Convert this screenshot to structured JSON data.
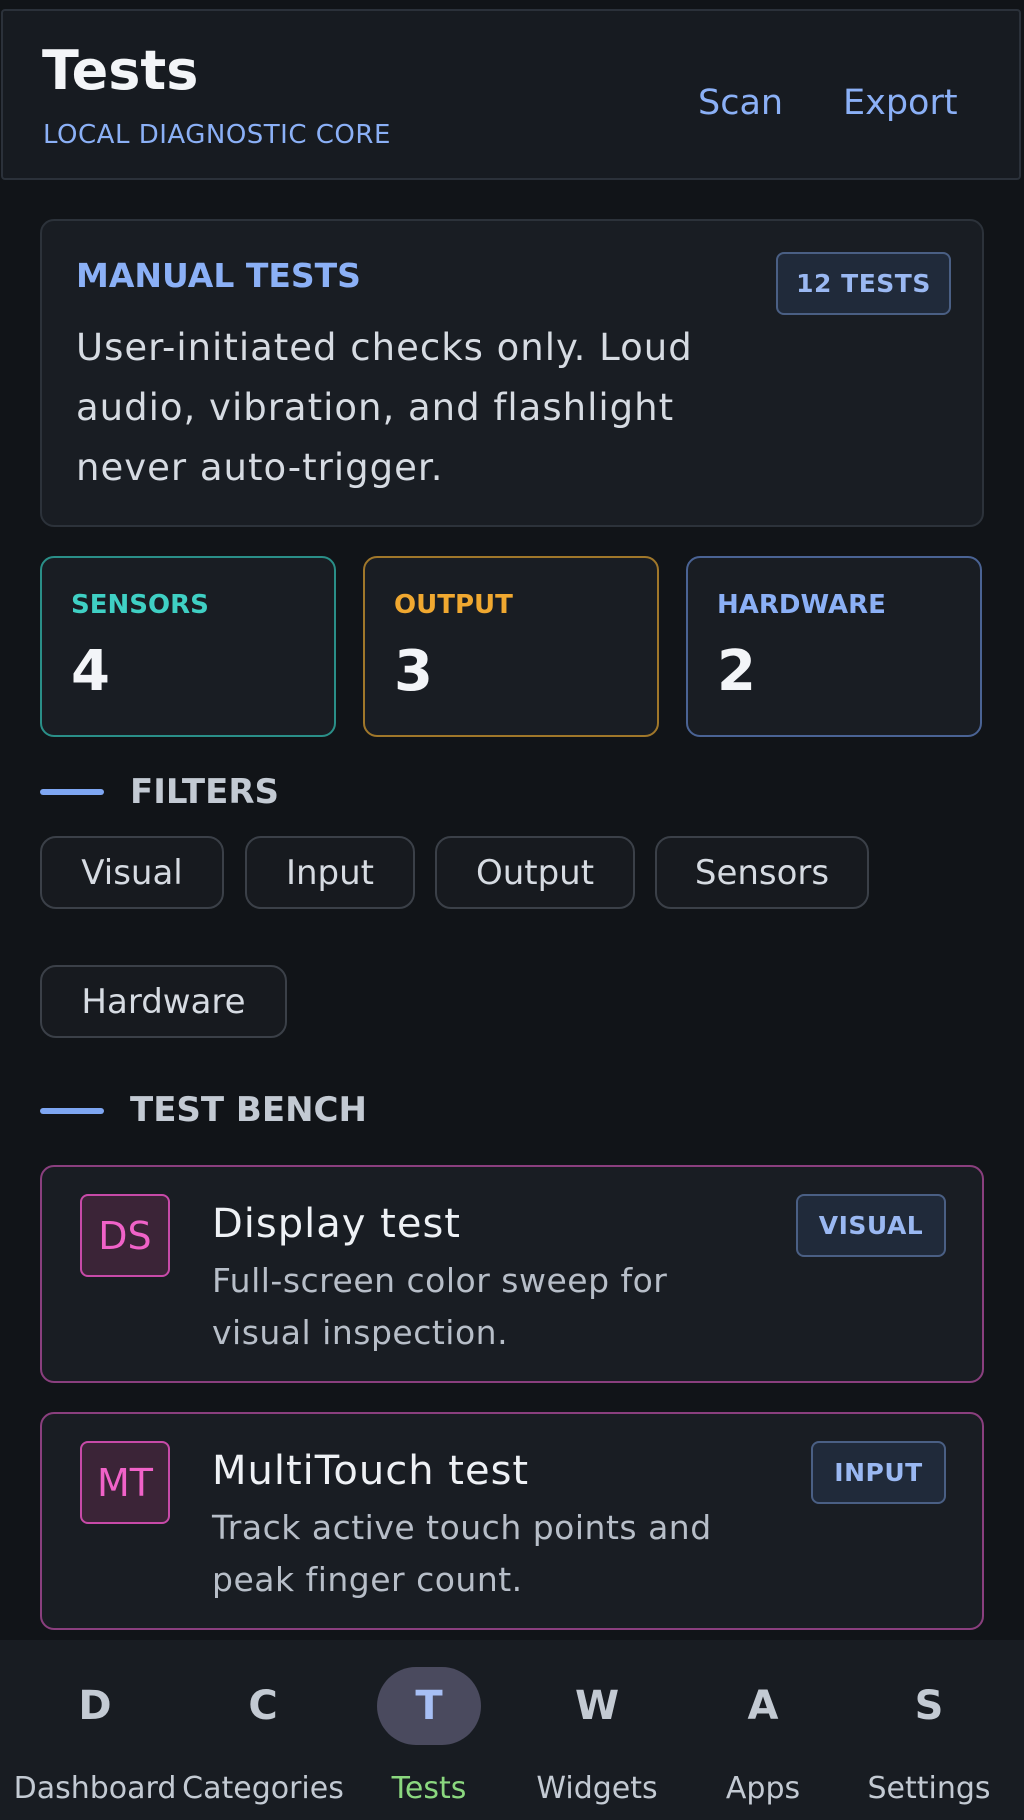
{
  "header": {
    "title": "Tests",
    "subtitle": "LOCAL DIAGNOSTIC CORE",
    "actions": [
      "Scan",
      "Export"
    ]
  },
  "intro": {
    "heading": "MANUAL TESTS",
    "badge": "12 TESTS",
    "text": "User-initiated checks only. Loud audio, vibration, and flashlight never auto-trigger."
  },
  "stats": [
    {
      "label": "SENSORS",
      "value": "4",
      "color": "#3fd0c4"
    },
    {
      "label": "OUTPUT",
      "value": "3",
      "color": "#f0a830"
    },
    {
      "label": "HARDWARE",
      "value": "2",
      "color": "#8bb0f6"
    }
  ],
  "filters": {
    "title": "FILTERS",
    "chips": [
      "Visual",
      "Input",
      "Output",
      "Sensors",
      "Hardware"
    ]
  },
  "bench": {
    "title": "TEST BENCH",
    "tests": [
      {
        "abbr": "DS",
        "title": "Display test",
        "description": "Full-screen color sweep for visual inspection.",
        "badge": "VISUAL"
      },
      {
        "abbr": "MT",
        "title": "MultiTouch test",
        "description": "Track active touch points and peak finger count.",
        "badge": "INPUT"
      }
    ]
  },
  "nav": {
    "items": [
      {
        "letter": "D",
        "label": "Dashboard"
      },
      {
        "letter": "C",
        "label": "Categories"
      },
      {
        "letter": "T",
        "label": "Tests"
      },
      {
        "letter": "W",
        "label": "Widgets"
      },
      {
        "letter": "A",
        "label": "Apps"
      },
      {
        "letter": "S",
        "label": "Settings"
      }
    ],
    "active": "Tests"
  }
}
